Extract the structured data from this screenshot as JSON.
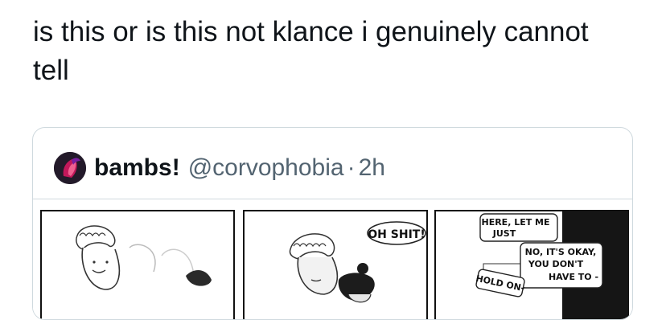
{
  "tweet": {
    "text": "is this or is this not klance i genuinely cannot tell"
  },
  "quoted_tweet": {
    "display_name": "bambs!",
    "handle": "@corvophobia",
    "separator": "·",
    "time": "2h",
    "comic": {
      "panel2_bubble": "OH SHIT!",
      "panel3_bubble1_line1": "HERE, LET ME",
      "panel3_bubble1_line2": "JUST",
      "panel3_bubble2_line1": "NO, IT'S OKAY,",
      "panel3_bubble2_line2": "YOU DON'T",
      "panel3_bubble2_line3": "HAVE TO -",
      "panel3_bubble3": "HOLD ON-"
    }
  }
}
